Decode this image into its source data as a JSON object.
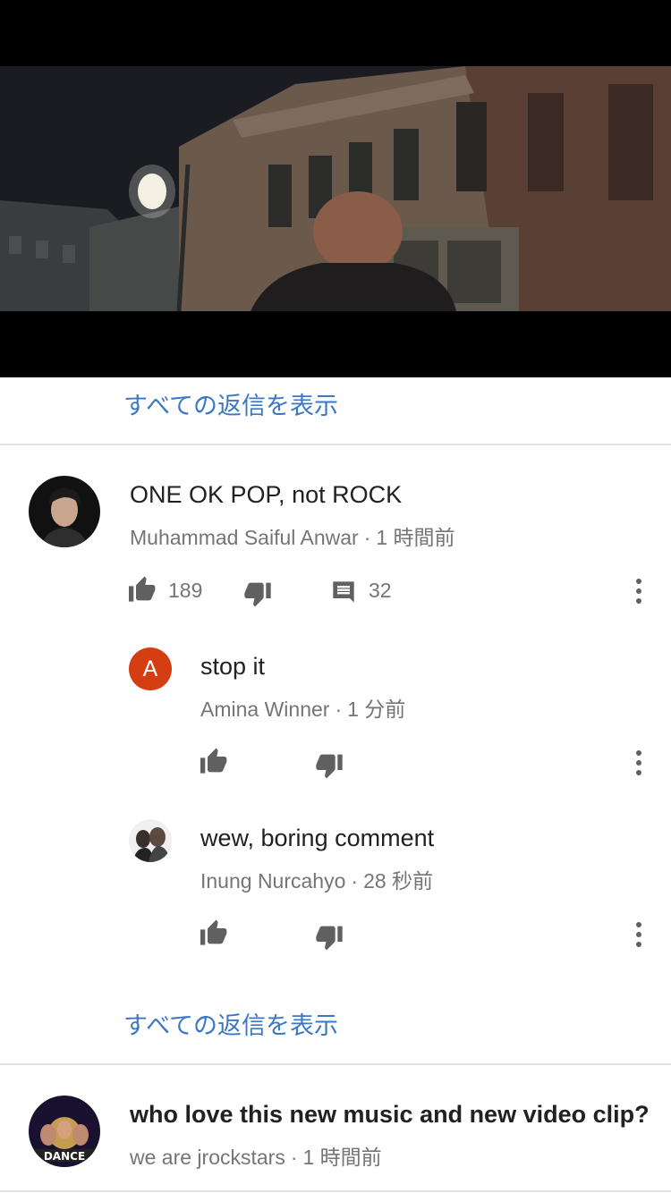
{
  "player": {
    "image": "night-street-video-frame"
  },
  "thread1": {
    "show_replies_label": "すべての返信を表示"
  },
  "comment_main": {
    "text": "ONE OK POP, not ROCK",
    "author": "Muhammad Saiful Anwar",
    "time": "1 時間前",
    "likes": "189",
    "replies": "32"
  },
  "replies": [
    {
      "text": "stop it",
      "author": "Amina Winner",
      "time": "1 分前",
      "avatar_letter": "A"
    },
    {
      "text": "wew, boring comment",
      "author": "Inung Nurcahyo",
      "time": "28 秒前"
    }
  ],
  "thread2": {
    "show_replies_label": "すべての返信を表示"
  },
  "comment_next": {
    "text": "who love this new music and new video clip?",
    "author": "we are jrockstars",
    "time": "1 時間前",
    "avatar_text": "DANCE"
  },
  "colors": {
    "link": "#3b78c4",
    "meta": "#757575",
    "letter_avatar": "#d53d12"
  }
}
